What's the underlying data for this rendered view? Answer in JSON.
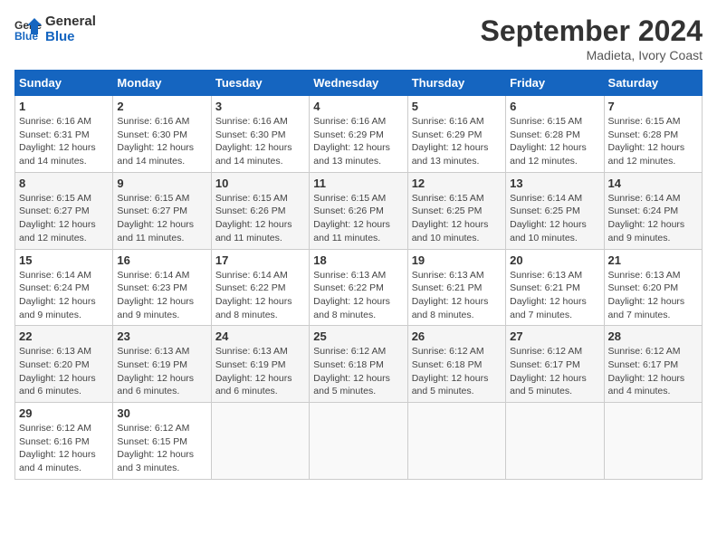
{
  "header": {
    "logo_line1": "General",
    "logo_line2": "Blue",
    "month": "September 2024",
    "location": "Madieta, Ivory Coast"
  },
  "days_of_week": [
    "Sunday",
    "Monday",
    "Tuesday",
    "Wednesday",
    "Thursday",
    "Friday",
    "Saturday"
  ],
  "weeks": [
    [
      {
        "day": "1",
        "info": "Sunrise: 6:16 AM\nSunset: 6:31 PM\nDaylight: 12 hours\nand 14 minutes."
      },
      {
        "day": "2",
        "info": "Sunrise: 6:16 AM\nSunset: 6:30 PM\nDaylight: 12 hours\nand 14 minutes."
      },
      {
        "day": "3",
        "info": "Sunrise: 6:16 AM\nSunset: 6:30 PM\nDaylight: 12 hours\nand 14 minutes."
      },
      {
        "day": "4",
        "info": "Sunrise: 6:16 AM\nSunset: 6:29 PM\nDaylight: 12 hours\nand 13 minutes."
      },
      {
        "day": "5",
        "info": "Sunrise: 6:16 AM\nSunset: 6:29 PM\nDaylight: 12 hours\nand 13 minutes."
      },
      {
        "day": "6",
        "info": "Sunrise: 6:15 AM\nSunset: 6:28 PM\nDaylight: 12 hours\nand 12 minutes."
      },
      {
        "day": "7",
        "info": "Sunrise: 6:15 AM\nSunset: 6:28 PM\nDaylight: 12 hours\nand 12 minutes."
      }
    ],
    [
      {
        "day": "8",
        "info": "Sunrise: 6:15 AM\nSunset: 6:27 PM\nDaylight: 12 hours\nand 12 minutes."
      },
      {
        "day": "9",
        "info": "Sunrise: 6:15 AM\nSunset: 6:27 PM\nDaylight: 12 hours\nand 11 minutes."
      },
      {
        "day": "10",
        "info": "Sunrise: 6:15 AM\nSunset: 6:26 PM\nDaylight: 12 hours\nand 11 minutes."
      },
      {
        "day": "11",
        "info": "Sunrise: 6:15 AM\nSunset: 6:26 PM\nDaylight: 12 hours\nand 11 minutes."
      },
      {
        "day": "12",
        "info": "Sunrise: 6:15 AM\nSunset: 6:25 PM\nDaylight: 12 hours\nand 10 minutes."
      },
      {
        "day": "13",
        "info": "Sunrise: 6:14 AM\nSunset: 6:25 PM\nDaylight: 12 hours\nand 10 minutes."
      },
      {
        "day": "14",
        "info": "Sunrise: 6:14 AM\nSunset: 6:24 PM\nDaylight: 12 hours\nand 9 minutes."
      }
    ],
    [
      {
        "day": "15",
        "info": "Sunrise: 6:14 AM\nSunset: 6:24 PM\nDaylight: 12 hours\nand 9 minutes."
      },
      {
        "day": "16",
        "info": "Sunrise: 6:14 AM\nSunset: 6:23 PM\nDaylight: 12 hours\nand 9 minutes."
      },
      {
        "day": "17",
        "info": "Sunrise: 6:14 AM\nSunset: 6:22 PM\nDaylight: 12 hours\nand 8 minutes."
      },
      {
        "day": "18",
        "info": "Sunrise: 6:13 AM\nSunset: 6:22 PM\nDaylight: 12 hours\nand 8 minutes."
      },
      {
        "day": "19",
        "info": "Sunrise: 6:13 AM\nSunset: 6:21 PM\nDaylight: 12 hours\nand 8 minutes."
      },
      {
        "day": "20",
        "info": "Sunrise: 6:13 AM\nSunset: 6:21 PM\nDaylight: 12 hours\nand 7 minutes."
      },
      {
        "day": "21",
        "info": "Sunrise: 6:13 AM\nSunset: 6:20 PM\nDaylight: 12 hours\nand 7 minutes."
      }
    ],
    [
      {
        "day": "22",
        "info": "Sunrise: 6:13 AM\nSunset: 6:20 PM\nDaylight: 12 hours\nand 6 minutes."
      },
      {
        "day": "23",
        "info": "Sunrise: 6:13 AM\nSunset: 6:19 PM\nDaylight: 12 hours\nand 6 minutes."
      },
      {
        "day": "24",
        "info": "Sunrise: 6:13 AM\nSunset: 6:19 PM\nDaylight: 12 hours\nand 6 minutes."
      },
      {
        "day": "25",
        "info": "Sunrise: 6:12 AM\nSunset: 6:18 PM\nDaylight: 12 hours\nand 5 minutes."
      },
      {
        "day": "26",
        "info": "Sunrise: 6:12 AM\nSunset: 6:18 PM\nDaylight: 12 hours\nand 5 minutes."
      },
      {
        "day": "27",
        "info": "Sunrise: 6:12 AM\nSunset: 6:17 PM\nDaylight: 12 hours\nand 5 minutes."
      },
      {
        "day": "28",
        "info": "Sunrise: 6:12 AM\nSunset: 6:17 PM\nDaylight: 12 hours\nand 4 minutes."
      }
    ],
    [
      {
        "day": "29",
        "info": "Sunrise: 6:12 AM\nSunset: 6:16 PM\nDaylight: 12 hours\nand 4 minutes."
      },
      {
        "day": "30",
        "info": "Sunrise: 6:12 AM\nSunset: 6:15 PM\nDaylight: 12 hours\nand 3 minutes."
      },
      {
        "day": "",
        "info": ""
      },
      {
        "day": "",
        "info": ""
      },
      {
        "day": "",
        "info": ""
      },
      {
        "day": "",
        "info": ""
      },
      {
        "day": "",
        "info": ""
      }
    ]
  ]
}
